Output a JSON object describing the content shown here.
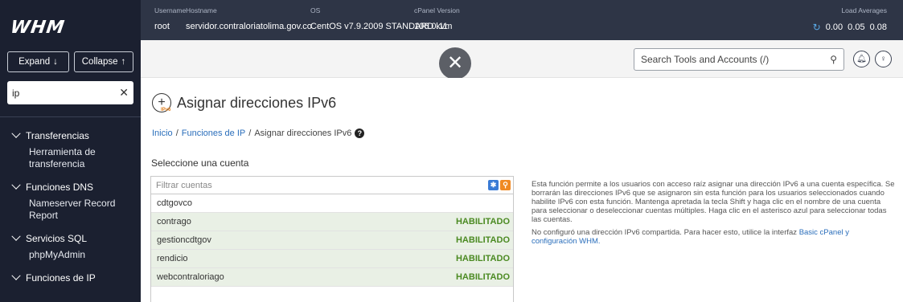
{
  "sidebar": {
    "logo": "WHM",
    "expand_label": "Expand",
    "collapse_label": "Collapse",
    "search_value": "ip",
    "nav": [
      {
        "group": "Transferencias",
        "items": [
          "Herramienta de transferencia"
        ]
      },
      {
        "group": "Funciones DNS",
        "items": [
          "Nameserver Record Report"
        ]
      },
      {
        "group": "Servicios SQL",
        "items": [
          "phpMyAdmin"
        ]
      },
      {
        "group": "Funciones de IP",
        "items": []
      }
    ]
  },
  "topbar": {
    "username_label": "Username",
    "hostname_label": "Hostname",
    "os_label": "OS",
    "cpanel_label": "cPanel Version",
    "username": "root",
    "hostname": "servidor.contraloriatolima.gov.co",
    "os": "CentOS v7.9.2009 STANDARD kvm",
    "cpanel_version": "106.0.11",
    "load_label": "Load Averages",
    "load_values": [
      "0.00",
      "0.05",
      "0.08"
    ]
  },
  "search": {
    "placeholder": "Search Tools and Accounts (/)"
  },
  "page": {
    "icon_tag": "IPv6",
    "title": "Asignar direcciones IPv6",
    "breadcrumb": {
      "home": "Inicio",
      "section": "Funciones de IP",
      "current": "Asignar direcciones IPv6"
    },
    "select_label": "Seleccione una cuenta",
    "filter_placeholder": "Filtrar cuentas",
    "accounts": [
      {
        "name": "cdtgovco",
        "status": ""
      },
      {
        "name": "contrago",
        "status": "HABILITADO"
      },
      {
        "name": "gestioncdtgov",
        "status": "HABILITADO"
      },
      {
        "name": "rendicio",
        "status": "HABILITADO"
      },
      {
        "name": "webcontraloriago",
        "status": "HABILITADO"
      }
    ],
    "info_p1": "Esta función permite a los usuarios con acceso raíz asignar una dirección IPv6 a una cuenta específica. Se borrarán las direcciones IPv6 que se asignaron sin esta función para los usuarios seleccionados cuando habilite IPv6 con esta función. Mantenga apretada la tecla Shift y haga clic en el nombre de una cuenta para seleccionar o deseleccionar cuentas múltiples. Haga clic en el asterisco azul para seleccionar todas las cuentas.",
    "info_p2_text": "No configuró una dirección IPv6 compartida. Para hacer esto, utilice la interfaz",
    "info_p2_link": "Basic cPanel y configuración WHM."
  },
  "colors": {
    "sidebar_bg": "#1b2030",
    "topbar_bg": "#2e3546",
    "enabled_green": "#4b8a22",
    "link_blue": "#2a6ebb"
  }
}
